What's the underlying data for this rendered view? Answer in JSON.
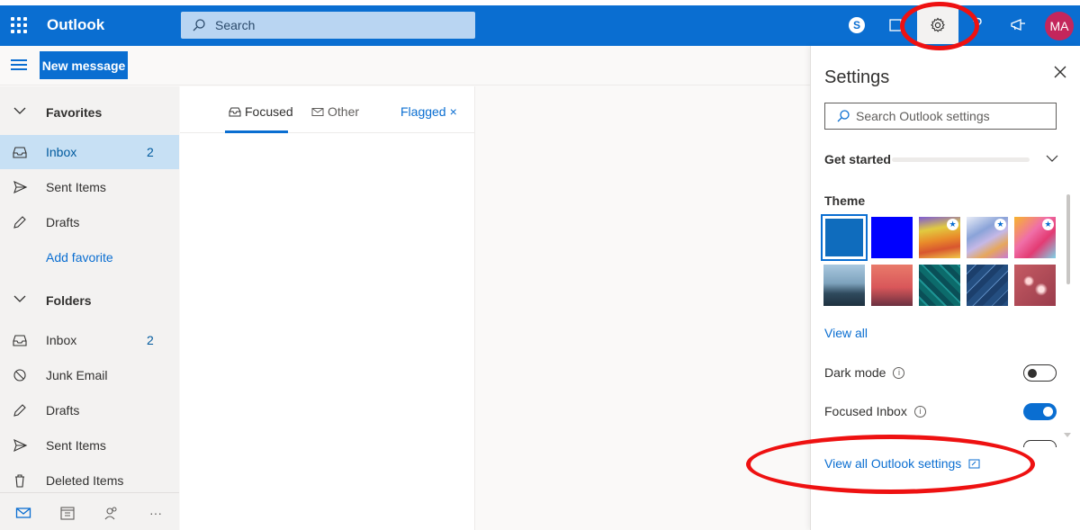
{
  "header": {
    "app_name": "Outlook",
    "search_placeholder": "Search",
    "skype_letter": "S",
    "avatar_initials": "MA"
  },
  "icons": {
    "waffle": "app-launcher-icon",
    "search": "search-icon",
    "skype": "skype-icon",
    "todo": "my-day-icon",
    "gear": "gear-icon",
    "help": "help-icon",
    "announce": "megaphone-icon"
  },
  "toolbar": {
    "new_message_label": "New message"
  },
  "nav": {
    "favorites_label": "Favorites",
    "folders_label": "Folders",
    "favorites": [
      {
        "label": "Inbox",
        "count": "2",
        "icon": "inbox-icon",
        "selected": true
      },
      {
        "label": "Sent Items",
        "count": "",
        "icon": "send-icon"
      },
      {
        "label": "Drafts",
        "count": "",
        "icon": "pencil-icon"
      }
    ],
    "add_favorite": "Add favorite",
    "folders": [
      {
        "label": "Inbox",
        "count": "2",
        "icon": "inbox-icon"
      },
      {
        "label": "Junk Email",
        "count": "",
        "icon": "blocked-icon"
      },
      {
        "label": "Drafts",
        "count": "",
        "icon": "pencil-icon"
      },
      {
        "label": "Sent Items",
        "count": "",
        "icon": "send-icon"
      },
      {
        "label": "Deleted Items",
        "count": "",
        "icon": "trash-icon"
      }
    ],
    "bottom_more": "···"
  },
  "message_list": {
    "tabs": {
      "focused": "Focused",
      "other": "Other",
      "flagged": "Flagged",
      "flagged_close": "×"
    }
  },
  "settings": {
    "title": "Settings",
    "search_placeholder": "Search Outlook settings",
    "get_started": "Get started",
    "theme_label": "Theme",
    "theme_swatches": [
      {
        "name": "theme-blue",
        "color": "#0f6cbd",
        "selected": true
      },
      {
        "name": "theme-deep-blue",
        "color": "#0000ff"
      },
      {
        "name": "theme-rainbow",
        "color": "#e0a430",
        "premium": true
      },
      {
        "name": "theme-ribbon",
        "color": "#8fa6d6",
        "premium": true
      },
      {
        "name": "theme-unicorn",
        "color": "#f06fa8",
        "premium": true
      },
      {
        "name": "theme-mountain",
        "color": "#47697f"
      },
      {
        "name": "theme-palms",
        "color": "#d9575a"
      },
      {
        "name": "theme-circuit",
        "color": "#0c6b6b"
      },
      {
        "name": "theme-blueprint",
        "color": "#244e80"
      },
      {
        "name": "theme-lights",
        "color": "#b85a62"
      }
    ],
    "view_all": "View all",
    "dark_mode_label": "Dark mode",
    "dark_mode_on": false,
    "focused_inbox_label": "Focused Inbox",
    "focused_inbox_on": true,
    "info_glyph": "i",
    "view_all_settings": "View all Outlook settings",
    "star_glyph": "★"
  },
  "colors": {
    "brand": "#0a6ed1",
    "annotation_red": "#ee1111"
  }
}
